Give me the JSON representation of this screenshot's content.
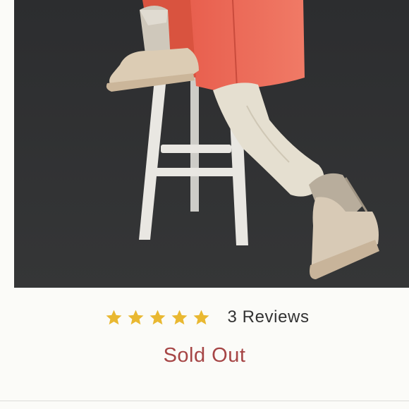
{
  "product_image": {
    "icon": "product-photo-boots"
  },
  "rating": {
    "stars_filled": 5,
    "stars_total": 5,
    "review_label": "3 Reviews",
    "star_color": "#e9b831"
  },
  "status": {
    "label": "Sold Out",
    "color": "#a64545"
  }
}
